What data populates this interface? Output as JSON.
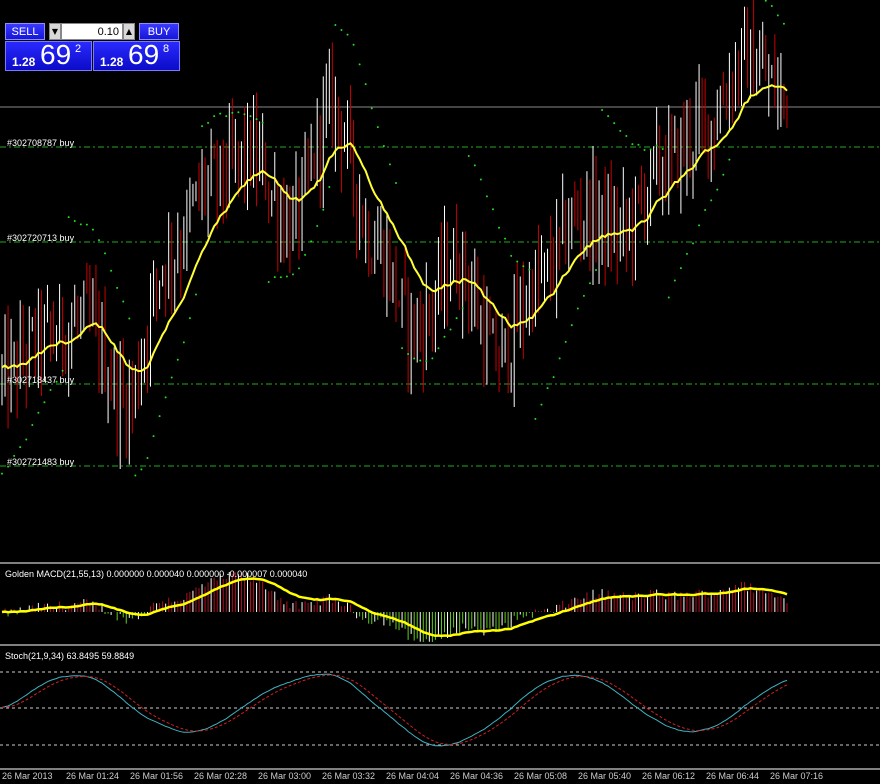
{
  "trade_panel": {
    "sell_label": "SELL",
    "buy_label": "BUY",
    "lot_value": "0.10",
    "sell_price": {
      "prefix": "1.28",
      "big": "69",
      "pip": "2"
    },
    "buy_price": {
      "prefix": "1.28",
      "big": "69",
      "pip": "8"
    }
  },
  "orders": [
    {
      "label": "#302708787 buy",
      "price": 0.8
    },
    {
      "label": "#302720713 buy",
      "price": -6.8
    },
    {
      "label": "#302718437 buy",
      "price": -18.2
    },
    {
      "label": "#302721483 buy",
      "price": -24.8
    }
  ],
  "indicators": {
    "macd_label": "Golden MACD(21,55,13) 0.000000 0.000040 0.000000 -0.000007 0.000040",
    "stoch_label": "Stoch(21,9,34) 63.8495 59.8849"
  },
  "time_axis": [
    "26 Mar 2013",
    "26 Mar 01:24",
    "26 Mar 01:56",
    "26 Mar 02:28",
    "26 Mar 03:00",
    "26 Mar 03:32",
    "26 Mar 04:04",
    "26 Mar 04:36",
    "26 Mar 05:08",
    "26 Mar 05:40",
    "26 Mar 06:12",
    "26 Mar 06:44",
    "26 Mar 07:16"
  ],
  "colors": {
    "background": "#000000",
    "bull": "#ffffff",
    "bear": "#c80000",
    "ma": "#ffff33",
    "sar": "#22dd22",
    "order_line": "#22aa22",
    "macd_signal": "#ffff00",
    "stoch_main": "#40b0c0",
    "stoch_signal": "#d02020"
  },
  "chart_data": {
    "type": "candlestick",
    "price_series_seed": [
      0,
      8,
      12,
      -5,
      25,
      40,
      46,
      32,
      56,
      28,
      10,
      24,
      4,
      20,
      34,
      30,
      44,
      52,
      66,
      58
    ],
    "sub_panels": [
      "macd",
      "stoch"
    ]
  }
}
